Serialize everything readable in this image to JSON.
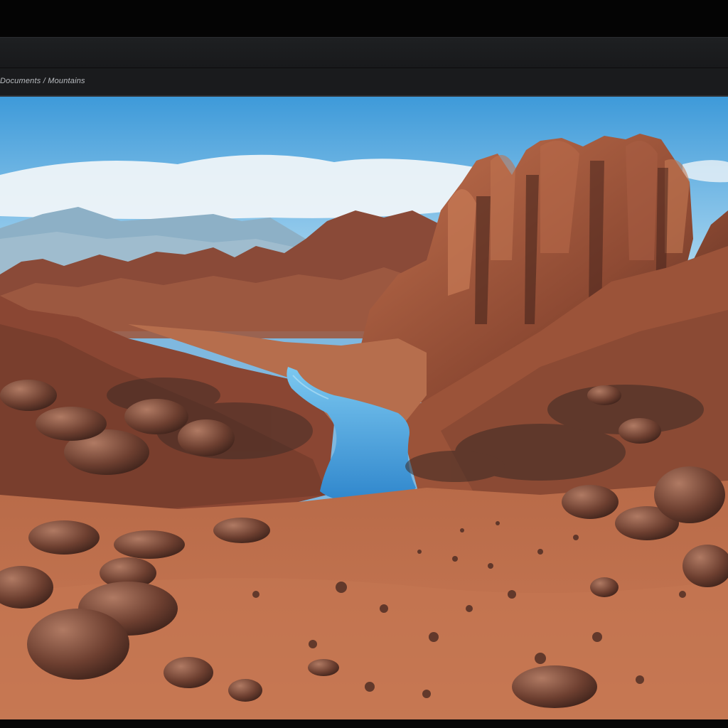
{
  "window": {
    "breadcrumb": "Documents / Mountains"
  },
  "viewer": {
    "image_subject": "desert canyon landscape with red rock formations and a blue river",
    "colors": {
      "sky_top": "#4aa3e0",
      "sky_horizon": "#d6ecf6",
      "rock": "#a8583c",
      "rock_shadow": "#5a2e22",
      "sand": "#c27350",
      "river": "#3f9ad8",
      "mountains": "#8fb3c8"
    }
  }
}
